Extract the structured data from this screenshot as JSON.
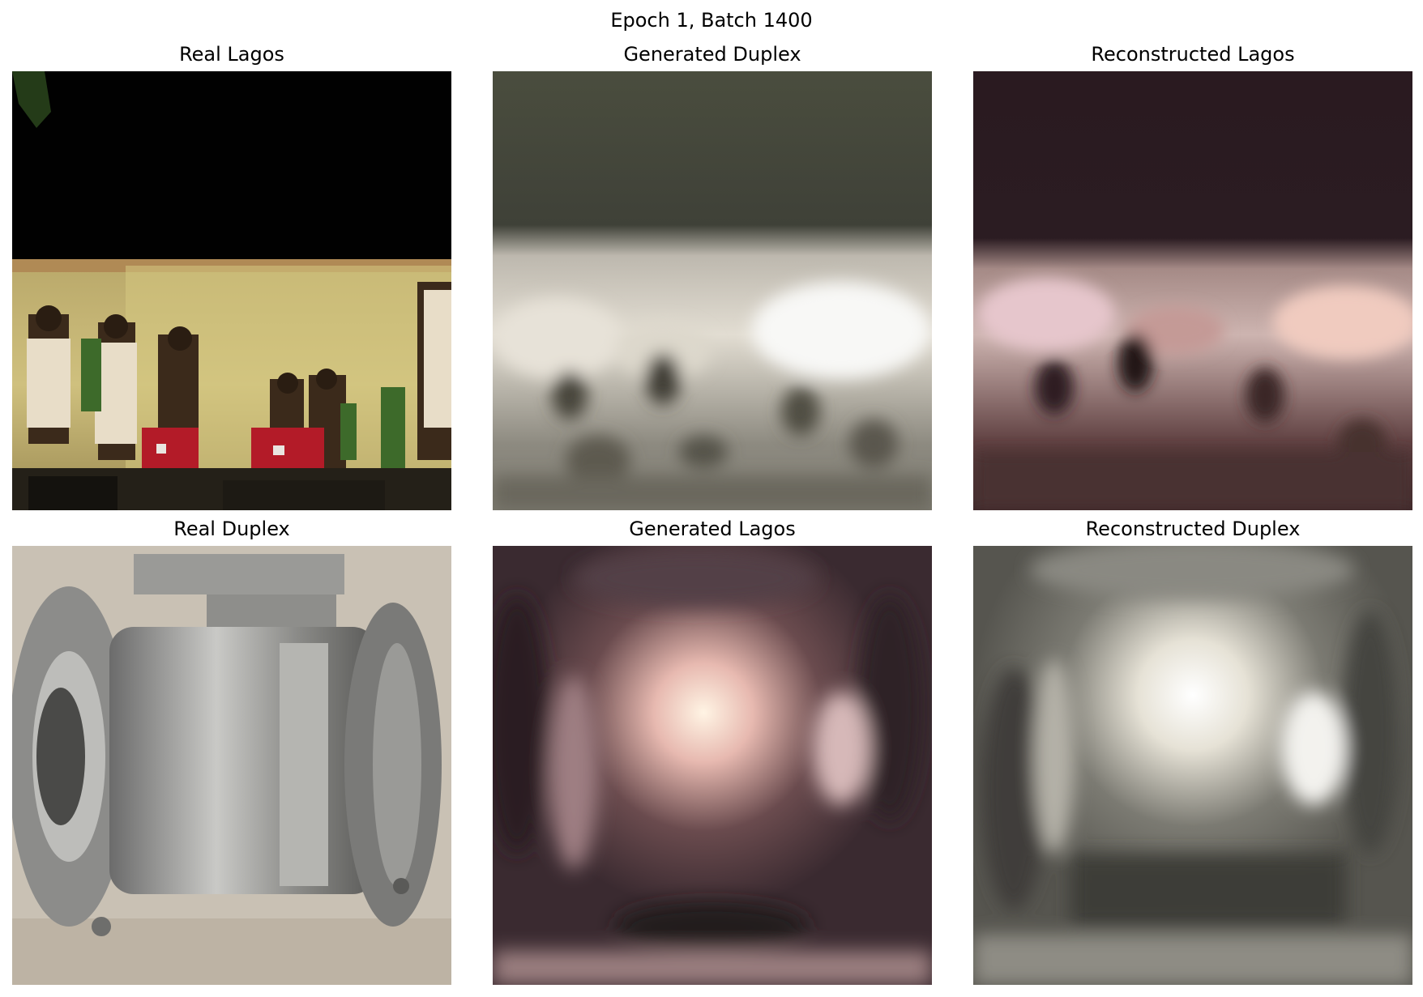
{
  "figure": {
    "suptitle": "Epoch 1, Batch 1400"
  },
  "panels": [
    {
      "title": "Real Lagos"
    },
    {
      "title": "Generated Duplex"
    },
    {
      "title": "Reconstructed Lagos"
    },
    {
      "title": "Real Duplex"
    },
    {
      "title": "Generated Lagos"
    },
    {
      "title": "Reconstructed Duplex"
    }
  ]
}
